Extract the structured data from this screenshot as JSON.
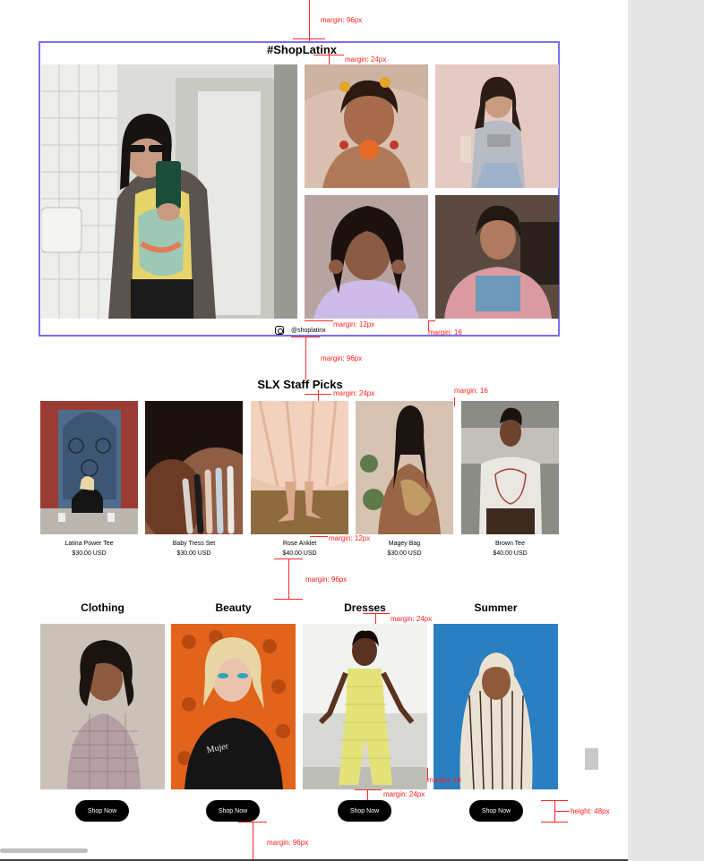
{
  "instagram": {
    "title": "#ShopLatinx",
    "handle": "@shoplatinx",
    "icon": "instagram-icon"
  },
  "staff_picks": {
    "title": "SLX Staff Picks",
    "products": [
      {
        "name": "Latina Power Tee",
        "price": "$30.00 USD"
      },
      {
        "name": "Baby Tress Set",
        "price": "$30.00 USD"
      },
      {
        "name": "Rose Anklet",
        "price": "$40.00 USD"
      },
      {
        "name": "Magey Bag",
        "price": "$30.00 USD"
      },
      {
        "name": "Brown Tee",
        "price": "$40.00 USD"
      }
    ]
  },
  "categories": [
    {
      "title": "Clothing",
      "button": "Shop Now"
    },
    {
      "title": "Beauty",
      "button": "Shop Now"
    },
    {
      "title": "Dresses",
      "button": "Shop Now"
    },
    {
      "title": "Summer",
      "button": "Shop Now"
    }
  ],
  "annotations": {
    "m96_top": "margin: 96px",
    "m24_ig": "margin: 24px",
    "m12_ig": "margin: 12px",
    "m16_ig": "margin: 16",
    "m96_mid": "margin: 96px",
    "m24_picks": "margin: 24px",
    "m16_picks": "margin: 16",
    "m12_picks": "margin: 12px",
    "m96_cat": "margin: 96px",
    "m24_cat_title": "margin: 24px",
    "m16_cat": "margin: 16",
    "m24_cat_btn": "margin: 24px",
    "height48": "height: 48px",
    "m96_bottom": "margin: 96px"
  },
  "colors": {
    "accent_frame": "#7b6ff0",
    "spec_red": "#ff2a2a",
    "button_bg": "#000000",
    "panel_gray": "#e6e6e6"
  }
}
